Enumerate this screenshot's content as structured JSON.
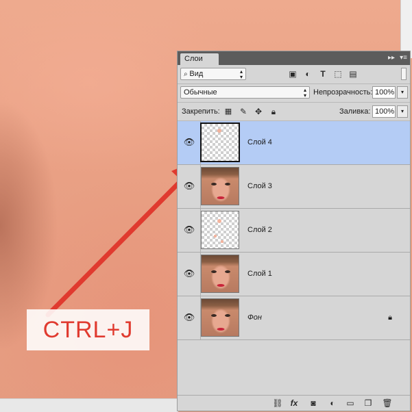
{
  "shortcut_label": "CTRL+J",
  "panel": {
    "tab_title": "Слои",
    "collapse_label": "▸▸",
    "menu_label": "▾≡",
    "filter": {
      "value": "Вид",
      "icon": "search-icon"
    },
    "filter_icons": [
      "image-icon",
      "adjustment-icon",
      "type-icon",
      "shape-icon",
      "smart-object-icon"
    ],
    "blend_mode": "Обычные",
    "opacity_label": "Непрозрачность:",
    "opacity_value": "100%",
    "lock_label": "Закрепить:",
    "lock_icons": [
      "lock-transparent-icon",
      "lock-brush-icon",
      "lock-move-icon",
      "lock-all-icon"
    ],
    "fill_label": "Заливка:",
    "fill_value": "100%",
    "layers": [
      {
        "name": "Слой 4",
        "selected": true,
        "thumb": "transparent-spot",
        "visible": true
      },
      {
        "name": "Слой 3",
        "selected": false,
        "thumb": "face",
        "visible": true
      },
      {
        "name": "Слой 2",
        "selected": false,
        "thumb": "transparent-spots",
        "visible": true
      },
      {
        "name": "Слой 1",
        "selected": false,
        "thumb": "face",
        "visible": true
      },
      {
        "name": "Фон",
        "selected": false,
        "thumb": "face",
        "visible": true,
        "locked": true,
        "italic": true
      }
    ],
    "bottom_icons": [
      "link-icon",
      "fx-icon",
      "mask-icon",
      "adjustment-layer-icon",
      "group-folder-icon",
      "new-layer-icon",
      "trash-icon"
    ],
    "fx_label": "fx"
  },
  "colors": {
    "selected_layer": "#b4ccf5",
    "arrow": "#e03a2f",
    "panel_bg": "#d6d6d6"
  }
}
